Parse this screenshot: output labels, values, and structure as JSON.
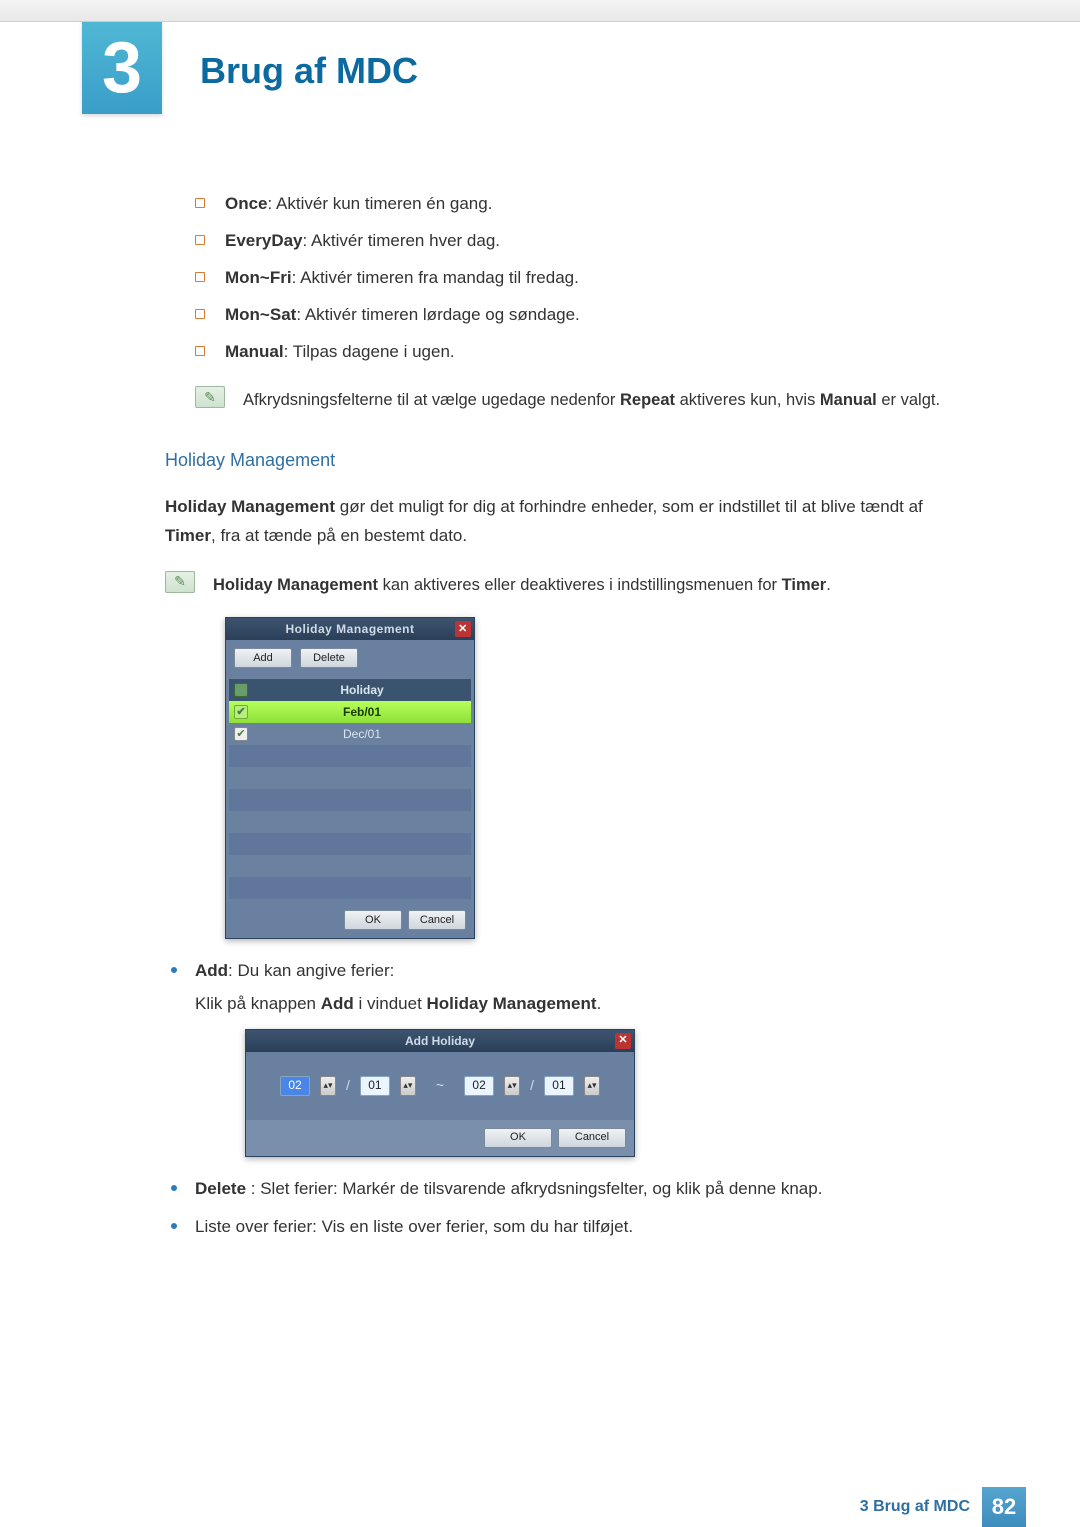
{
  "chapter": {
    "number": "3",
    "title": "Brug af MDC"
  },
  "repeat_options": [
    {
      "label": "Once",
      "desc": ": Aktivér kun timeren én gang."
    },
    {
      "label": "EveryDay",
      "desc": ": Aktivér timeren hver dag."
    },
    {
      "label": "Mon~Fri",
      "desc": ": Aktivér timeren fra mandag til fredag."
    },
    {
      "label": "Mon~Sat",
      "desc": ": Aktivér timeren lørdage og søndage."
    },
    {
      "label": "Manual",
      "desc": ": Tilpas dagene i ugen."
    }
  ],
  "note1": {
    "pre": "Afkrydsningsfelterne til at vælge ugedage nedenfor ",
    "b1": "Repeat",
    "mid": " aktiveres kun, hvis ",
    "b2": "Manual",
    "post": " er valgt."
  },
  "hm_section_title": "Holiday Management",
  "hm_intro": {
    "b1": "Holiday Management",
    "t1": " gør det muligt for dig at forhindre enheder, som er indstillet til at blive tændt af ",
    "b2": "Timer",
    "t2": ", fra at tænde på en bestemt dato."
  },
  "note2": {
    "b1": "Holiday Management",
    "t1": " kan aktiveres eller deaktiveres i indstillingsmenuen for ",
    "b2": "Timer",
    "t2": "."
  },
  "hm_dialog": {
    "title": "Holiday Management",
    "add_btn": "Add",
    "delete_btn": "Delete",
    "col_header": "Holiday",
    "rows": [
      "Feb/01",
      "Dec/01"
    ],
    "ok_btn": "OK",
    "cancel_btn": "Cancel"
  },
  "add_text": {
    "b1": "Add",
    "t1": ": Du kan angive ferier:",
    "sub_pre": "Klik på knappen ",
    "sub_b1": "Add",
    "sub_mid": " i vinduet ",
    "sub_b2": "Holiday Management",
    "sub_post": "."
  },
  "ah_dialog": {
    "title": "Add Holiday",
    "month1": "02",
    "day1": "01",
    "month2": "02",
    "day2": "01",
    "ok_btn": "OK",
    "cancel_btn": "Cancel"
  },
  "delete_text": {
    "b1": "Delete",
    "t1": " : Slet ferier: Markér de tilsvarende afkrydsningsfelter, og klik på denne knap."
  },
  "list_text": "Liste over ferier: Vis en liste over ferier, som du har tilføjet.",
  "footer": {
    "label": "3 Brug af MDC",
    "page": "82"
  }
}
